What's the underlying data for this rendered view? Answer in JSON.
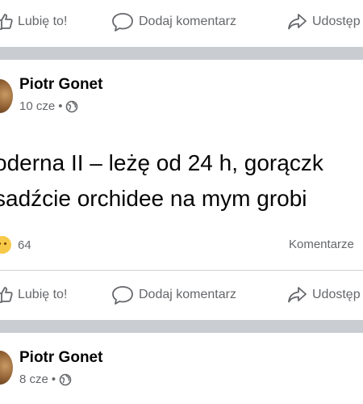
{
  "actions": {
    "like_label": "Lubię to!",
    "comment_label": "Dodaj komentarz",
    "share_label": "Udostęp"
  },
  "posts": [
    {
      "author": "Piotr Gonet",
      "time": "10 cze",
      "privacy_icon": "globe-icon",
      "text_lines": [
        "oderna II – leżę od 24 h, gorączk",
        "sadźcie orchidee na mym grobi"
      ],
      "reaction_icon": "sad-face-icon",
      "reaction_count": "64",
      "comments_label": "Komentarze"
    },
    {
      "author": "Piotr Gonet",
      "time": "8 cze",
      "privacy_icon": "globe-icon"
    }
  ],
  "colors": {
    "separator": "#c9ccd1",
    "secondary_text": "#65676b",
    "primary_text": "#050505",
    "reaction_yellow": "#f7c948"
  }
}
